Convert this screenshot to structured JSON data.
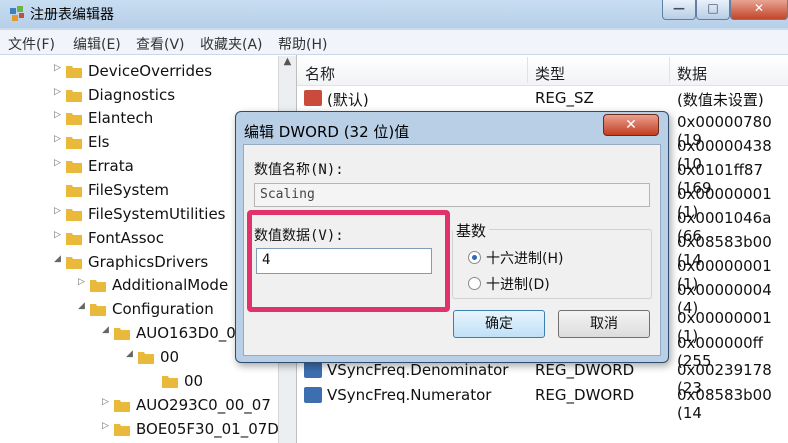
{
  "window": {
    "title": "注册表编辑器",
    "min": "—",
    "max": "□",
    "close": "✕"
  },
  "menu": [
    "文件(F)",
    "编辑(E)",
    "查看(V)",
    "收藏夹(A)",
    "帮助(H)"
  ],
  "tree": [
    {
      "label": "DeviceOverrides",
      "expander": "▷"
    },
    {
      "label": "Diagnostics",
      "expander": "▷"
    },
    {
      "label": "Elantech",
      "expander": "▷"
    },
    {
      "label": "Els",
      "expander": "▷"
    },
    {
      "label": "Errata",
      "expander": "▷"
    },
    {
      "label": "FileSystem",
      "expander": ""
    },
    {
      "label": "FileSystemUtilities",
      "expander": "▷"
    },
    {
      "label": "FontAssoc",
      "expander": "▷"
    },
    {
      "label": "GraphicsDrivers",
      "expander": "◢"
    },
    {
      "label": "AdditionalMode",
      "expander": "▷"
    },
    {
      "label": "Configuration",
      "expander": "◢"
    },
    {
      "label": "AUO163D0_0",
      "expander": "◢"
    },
    {
      "label": "00",
      "expander": "◢"
    },
    {
      "label": "00",
      "expander": ""
    },
    {
      "label": "AUO293C0_00_07",
      "expander": "▷"
    },
    {
      "label": "BOE05F30_01_07D",
      "expander": "▷"
    }
  ],
  "columns": {
    "name": "名称",
    "type": "类型",
    "data": "数据"
  },
  "rows": [
    {
      "name": "(默认)",
      "type": "REG_SZ",
      "data": "(数值未设置)",
      "icon": "string-value-icon"
    },
    {
      "name": "",
      "type": "",
      "data": "0x00000780 (19",
      "icon": "dword-value-icon"
    },
    {
      "name": "",
      "type": "",
      "data": "0x00000438 (10",
      "icon": "dword-value-icon"
    },
    {
      "name": "",
      "type": "",
      "data": "0x0101ff87 (169",
      "icon": "dword-value-icon"
    },
    {
      "name": "",
      "type": "",
      "data": "0x00000001 (1)",
      "icon": "dword-value-icon"
    },
    {
      "name": "",
      "type": "",
      "data": "0x0001046a (66",
      "icon": "dword-value-icon"
    },
    {
      "name": "",
      "type": "",
      "data": "0x08583b00 (14",
      "icon": "dword-value-icon"
    },
    {
      "name": "",
      "type": "",
      "data": "0x00000001 (1)",
      "icon": "dword-value-icon"
    },
    {
      "name": "",
      "type": "",
      "data": "0x00000004 (4)",
      "icon": "dword-value-icon"
    },
    {
      "name": "",
      "type": "",
      "data": "0x00000001 (1)",
      "icon": "dword-value-icon"
    },
    {
      "name": "",
      "type": "",
      "data": "0x000000ff (255",
      "icon": "dword-value-icon"
    },
    {
      "name": "VSyncFreq.Denominator",
      "type": "REG_DWORD",
      "data": "0x00239178 (23",
      "icon": "dword-value-icon"
    },
    {
      "name": "VSyncFreq.Numerator",
      "type": "REG_DWORD",
      "data": "0x08583b00 (14",
      "icon": "dword-value-icon"
    }
  ],
  "dialog": {
    "title": "编辑 DWORD (32 位)值",
    "close": "✕",
    "name_label": "数值名称(N):",
    "name_value": "Scaling",
    "data_label": "数值数据(V):",
    "data_value": "4",
    "base_label": "基数",
    "hex_label": "十六进制(H)",
    "dec_label": "十进制(D)",
    "ok": "确定",
    "cancel": "取消"
  },
  "colors": {
    "highlight": "#e0336b",
    "folder": "#e8b93a"
  }
}
